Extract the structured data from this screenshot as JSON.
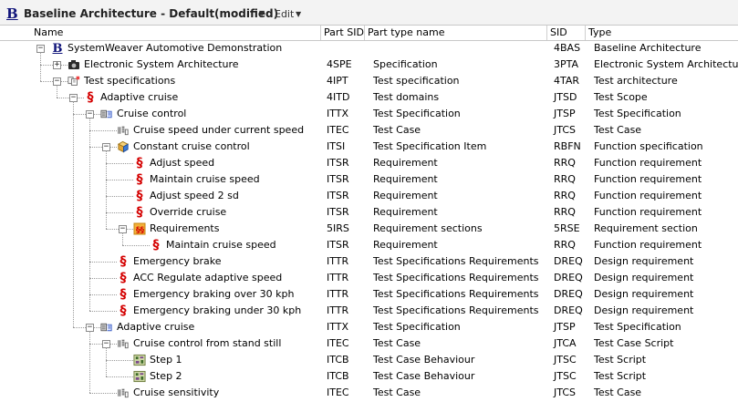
{
  "titlebar": {
    "logo": "B",
    "title": "Baseline Architecture - Default(modified)",
    "edit_menu": "Edit"
  },
  "columns": [
    "Name",
    "Part SID",
    "Part type name",
    "SID",
    "Type"
  ],
  "rows": [
    {
      "depth": 0,
      "expander": "minus",
      "icon": "baseline-icon",
      "name": "SystemWeaver Automotive Demonstration",
      "part_sid": "",
      "part_type": "",
      "sid": "4BAS",
      "type": "Baseline Architecture"
    },
    {
      "depth": 1,
      "expander": "plus",
      "icon": "camera-icon",
      "name": "Electronic System Architecture",
      "part_sid": "4SPE",
      "part_type": "Specification",
      "sid": "3PTA",
      "type": "Electronic System Architecture"
    },
    {
      "depth": 1,
      "expander": "minus",
      "icon": "test-architecture-icon",
      "name": "Test specifications",
      "part_sid": "4IPT",
      "part_type": "Test specification",
      "sid": "4TAR",
      "type": "Test architecture"
    },
    {
      "depth": 2,
      "expander": "minus",
      "icon": "requirement-section-icon",
      "name": "Adaptive cruise",
      "part_sid": "4ITD",
      "part_type": "Test domains",
      "sid": "JTSD",
      "type": "Test Scope"
    },
    {
      "depth": 3,
      "expander": "minus",
      "icon": "test-specification-icon",
      "name": "Cruise control",
      "part_sid": "ITTX",
      "part_type": "Test Specification",
      "sid": "JTSP",
      "type": "Test Specification"
    },
    {
      "depth": 4,
      "expander": "none",
      "icon": "test-case-icon",
      "name": "Cruise speed under current speed",
      "part_sid": "ITEC",
      "part_type": "Test Case",
      "sid": "JTCS",
      "type": "Test Case"
    },
    {
      "depth": 4,
      "expander": "minus",
      "icon": "function-cube-icon",
      "name": "Constant cruise control",
      "part_sid": "ITSI",
      "part_type": "Test Specification Item",
      "sid": "RBFN",
      "type": "Function specification"
    },
    {
      "depth": 5,
      "expander": "none",
      "icon": "requirement-icon",
      "name": "Adjust speed",
      "part_sid": "ITSR",
      "part_type": "Requirement",
      "sid": "RRQ",
      "type": "Function requirement"
    },
    {
      "depth": 5,
      "expander": "none",
      "icon": "requirement-icon",
      "name": "Maintain cruise speed",
      "part_sid": "ITSR",
      "part_type": "Requirement",
      "sid": "RRQ",
      "type": "Function requirement"
    },
    {
      "depth": 5,
      "expander": "none",
      "icon": "requirement-icon",
      "name": "Adjust speed 2 sd",
      "part_sid": "ITSR",
      "part_type": "Requirement",
      "sid": "RRQ",
      "type": "Function requirement"
    },
    {
      "depth": 5,
      "expander": "none",
      "icon": "requirement-icon",
      "name": "Override cruise",
      "part_sid": "ITSR",
      "part_type": "Requirement",
      "sid": "RRQ",
      "type": "Function requirement"
    },
    {
      "depth": 5,
      "expander": "minus",
      "icon": "requirement-sections-icon",
      "name": "Requirements",
      "part_sid": "5IRS",
      "part_type": "Requirement sections",
      "sid": "5RSE",
      "type": "Requirement section"
    },
    {
      "depth": 6,
      "expander": "none",
      "icon": "requirement-icon",
      "name": "Maintain cruise speed",
      "part_sid": "ITSR",
      "part_type": "Requirement",
      "sid": "RRQ",
      "type": "Function requirement"
    },
    {
      "depth": 4,
      "expander": "none",
      "icon": "requirement-icon",
      "name": "Emergency brake",
      "part_sid": "ITTR",
      "part_type": "Test Specifications Requirements",
      "sid": "DREQ",
      "type": "Design requirement"
    },
    {
      "depth": 4,
      "expander": "none",
      "icon": "requirement-icon",
      "name": "ACC Regulate adaptive speed",
      "part_sid": "ITTR",
      "part_type": "Test Specifications Requirements",
      "sid": "DREQ",
      "type": "Design requirement"
    },
    {
      "depth": 4,
      "expander": "none",
      "icon": "requirement-icon",
      "name": "Emergency braking over 30 kph",
      "part_sid": "ITTR",
      "part_type": "Test Specifications Requirements",
      "sid": "DREQ",
      "type": "Design requirement"
    },
    {
      "depth": 4,
      "expander": "none",
      "icon": "requirement-icon",
      "name": "Emergency braking under 30 kph",
      "part_sid": "ITTR",
      "part_type": "Test Specifications Requirements",
      "sid": "DREQ",
      "type": "Design requirement"
    },
    {
      "depth": 3,
      "expander": "minus",
      "icon": "test-specification-icon",
      "name": "Adaptive cruise",
      "part_sid": "ITTX",
      "part_type": "Test Specification",
      "sid": "JTSP",
      "type": "Test Specification"
    },
    {
      "depth": 4,
      "expander": "minus",
      "icon": "test-case-icon",
      "name": "Cruise control from stand still",
      "part_sid": "ITEC",
      "part_type": "Test Case",
      "sid": "JTCA",
      "type": "Test Case Script"
    },
    {
      "depth": 5,
      "expander": "none",
      "icon": "test-step-icon",
      "name": "Step 1",
      "part_sid": "ITCB",
      "part_type": "Test Case Behaviour",
      "sid": "JTSC",
      "type": "Test Script"
    },
    {
      "depth": 5,
      "expander": "none",
      "icon": "test-step-icon",
      "name": "Step 2",
      "part_sid": "ITCB",
      "part_type": "Test Case Behaviour",
      "sid": "JTSC",
      "type": "Test Script"
    },
    {
      "depth": 4,
      "expander": "none",
      "icon": "test-case-icon",
      "name": "Cruise sensitivity",
      "part_sid": "ITEC",
      "part_type": "Test Case",
      "sid": "JTCS",
      "type": "Test Case"
    }
  ]
}
